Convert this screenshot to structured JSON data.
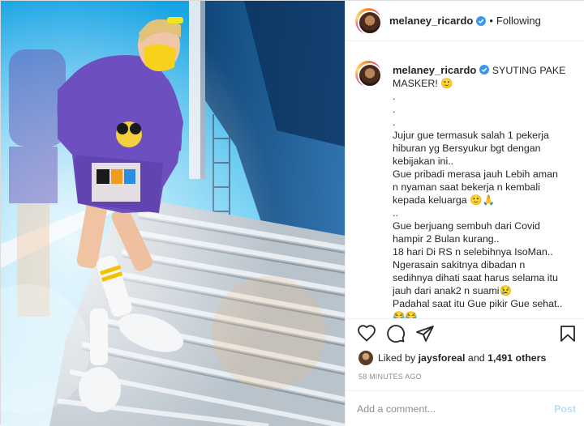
{
  "post": {
    "username": "melaney_ricardo",
    "follow_status": "Following",
    "separator": "•",
    "caption_lines": [
      "SYUTING PAKE",
      "MASKER! 🙂",
      ".",
      ".",
      ".",
      "Jujur gue termasuk salah 1 pekerja",
      "hiburan yg Bersyukur bgt dengan",
      "kebijakan ini..",
      "Gue pribadi merasa jauh Lebih aman",
      "n nyaman saat bekerja n kembali",
      "kepada keluarga 🙂🙏",
      "..",
      "Gue berjuang sembuh dari Covid",
      "hampir 2 Bulan kurang..",
      "18 hari Di RS n selebihnya IsoMan..",
      "Ngerasain sakitnya dibadan n",
      "sedihnya dihati saat harus selama itu",
      "jauh dari anak2 n suami😢",
      "Padahal saat itu Gue pikir Gue sehat..",
      "😂😂"
    ],
    "liked_by_prefix": "Liked by",
    "liked_by_user": "jaysforeal",
    "liked_by_and": "and",
    "liked_by_count": "1,491 others",
    "time_ago": "58 MINUTES AGO",
    "comment_placeholder": "Add a comment...",
    "post_label": "Post"
  },
  "icons": {
    "verified": "verified-badge-icon",
    "like": "heart-icon",
    "comment": "comment-icon",
    "share": "paper-plane-icon",
    "save": "bookmark-icon"
  },
  "colors": {
    "verified": "#3897f0",
    "post_disabled": "#b2dffc",
    "meta_gray": "#8e8e8e"
  }
}
